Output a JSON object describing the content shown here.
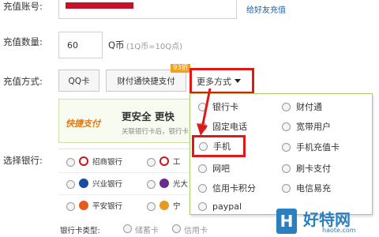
{
  "account": {
    "label": "充值账号:",
    "friend_link": "给好友充值"
  },
  "quantity": {
    "label": "充值数量:",
    "value": "60",
    "unit": "Q币",
    "note": "(1Q币=10Q点)"
  },
  "method": {
    "label": "充值方式:",
    "tabs": [
      "QQ卡",
      "财付通快捷支付",
      "更多方式"
    ],
    "discount_badge": "93折",
    "banner_logo": "快捷支付",
    "banner_title": "更安全 更快",
    "banner_sub": "关联银行卡后，银行卡"
  },
  "dropdown": {
    "items": [
      {
        "label": "银行卡",
        "selected": false
      },
      {
        "label": "财付通",
        "selected": false
      },
      {
        "label": "固定电话",
        "selected": false
      },
      {
        "label": "宽带用户",
        "selected": false
      },
      {
        "label": "手机",
        "selected": true
      },
      {
        "label": "手机充值卡",
        "selected": false
      },
      {
        "label": "网吧",
        "selected": false
      },
      {
        "label": "刷卡支付",
        "selected": false
      },
      {
        "label": "信用卡积分",
        "selected": false
      },
      {
        "label": "电信易充",
        "selected": false
      },
      {
        "label": "paypal",
        "selected": false
      }
    ]
  },
  "bank": {
    "label": "选择银行:",
    "banks": [
      {
        "name": "招商银行",
        "color": "#c8161d"
      },
      {
        "name": "工",
        "color": "#c8161d"
      },
      {
        "name": "兴业银行",
        "color": "#1b4b9c"
      },
      {
        "name": "光大",
        "color": "#6a2c8c"
      },
      {
        "name": "平安银行",
        "color": "#e85a1b"
      },
      {
        "name": "宁",
        "color": "#e39a1e"
      }
    ],
    "card_type_label": "银行卡类型:",
    "card_types": [
      "储蓄卡",
      "信用卡"
    ]
  },
  "watermark": {
    "text": "好特网",
    "sub": "haote.com",
    "color": "#2a7fc0"
  },
  "colors": {
    "highlight": "#e01818",
    "accent_border": "#f0a020",
    "dropdown_border": "#a8cf6a"
  }
}
